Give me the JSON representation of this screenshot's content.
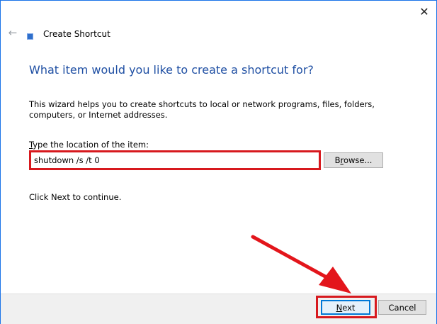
{
  "window": {
    "close_glyph": "✕",
    "back_glyph": "←",
    "title": "Create Shortcut"
  },
  "main": {
    "heading": "What item would you like to create a shortcut for?",
    "description": "This wizard helps you to create shortcuts to local or network programs, files, folders, computers, or Internet addresses.",
    "field_label_accel": "T",
    "field_label_rest": "ype the location of the item:",
    "location_value": "shutdown /s /t 0",
    "browse_accel": "r",
    "browse_pre": "B",
    "browse_post": "owse...",
    "hint": "Click Next to continue."
  },
  "footer": {
    "next_accel": "N",
    "next_rest": "ext",
    "cancel_label": "Cancel"
  },
  "colors": {
    "heading": "#1f4fa3",
    "highlight": "#d7191e",
    "window_border": "#1a73e8"
  }
}
